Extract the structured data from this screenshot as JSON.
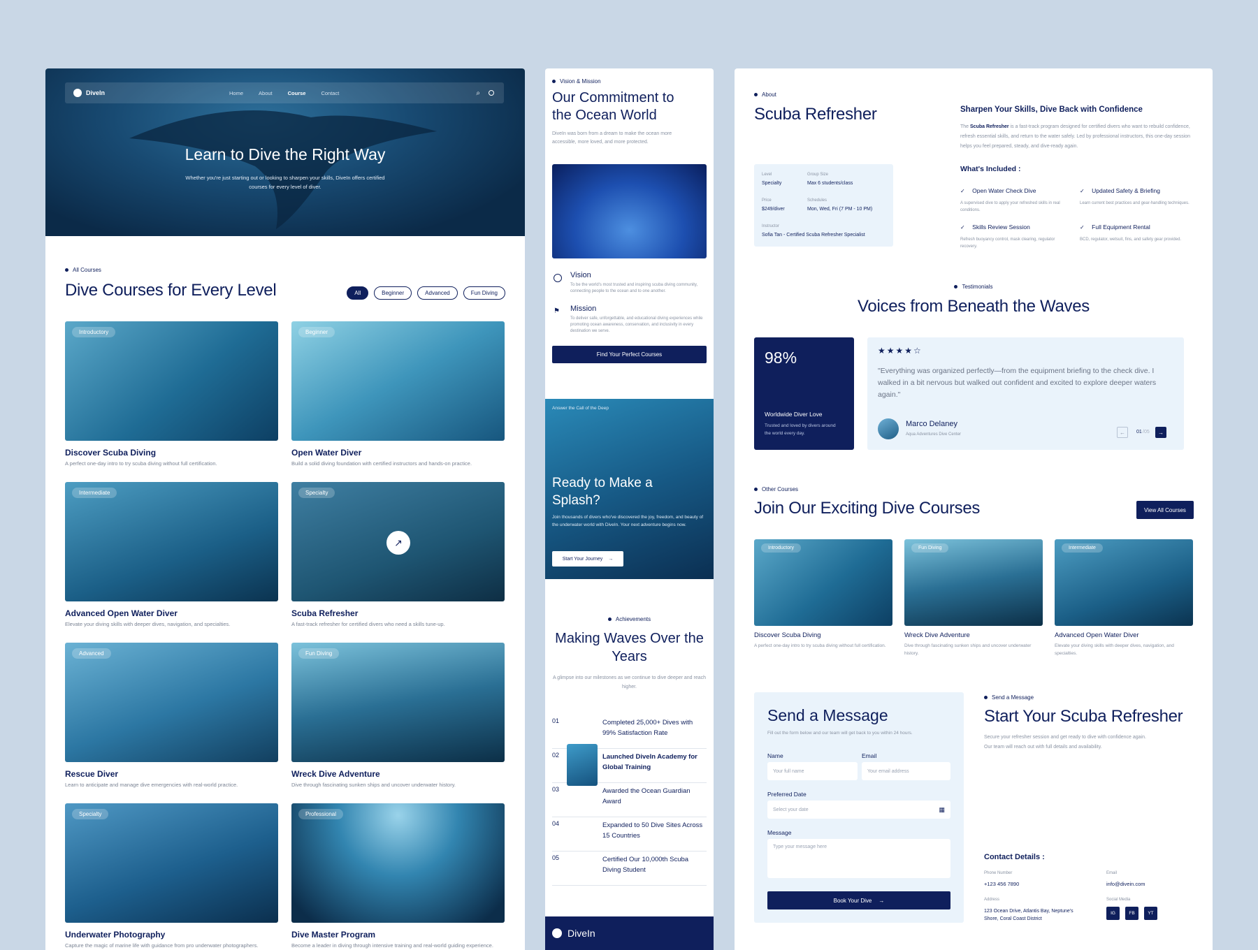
{
  "panel1": {
    "brand": "DiveIn",
    "nav": [
      "Home",
      "About",
      "Course",
      "Contact"
    ],
    "hero_title": "Learn to Dive the Right Way",
    "hero_sub": "Whether you're just starting out or looking to sharpen your skills, DiveIn offers certified courses for every level of diver.",
    "section_label": "All Courses",
    "section_title": "Dive Courses for Every Level",
    "filters": [
      "All",
      "Beginner",
      "Advanced",
      "Fun Diving"
    ],
    "courses": [
      {
        "tag": "Introductory",
        "title": "Discover Scuba Diving",
        "desc": "A perfect one-day intro to try scuba diving without full certification."
      },
      {
        "tag": "Beginner",
        "title": "Open Water Diver",
        "desc": "Build a solid diving foundation with certified instructors and hands-on practice."
      },
      {
        "tag": "Intermediate",
        "title": "Advanced Open Water Diver",
        "desc": "Elevate your diving skills with deeper dives, navigation, and specialties."
      },
      {
        "tag": "Specialty",
        "title": "Scuba Refresher",
        "desc": "A fast-track refresher for certified divers who need a skills tune-up."
      },
      {
        "tag": "Advanced",
        "title": "Rescue Diver",
        "desc": "Learn to anticipate and manage dive emergencies with real-world practice."
      },
      {
        "tag": "Fun Diving",
        "title": "Wreck Dive Adventure",
        "desc": "Dive through fascinating sunken ships and uncover underwater history."
      },
      {
        "tag": "Specialty",
        "title": "Underwater Photography",
        "desc": "Capture the magic of marine life with guidance from pro underwater photographers."
      },
      {
        "tag": "Professional",
        "title": "Dive Master Program",
        "desc": "Become a leader in diving through intensive training and real-world guiding experience."
      }
    ]
  },
  "panel2": {
    "label": "Vision & Mission",
    "title": "Our Commitment to the Ocean World",
    "desc": "DiveIn was born from a dream to make the ocean more accessible, more loved, and more protected.",
    "vision_title": "Vision",
    "vision_desc": "To be the world's most trusted and inspiring scuba diving community, connecting people to the ocean and to one another.",
    "mission_title": "Mission",
    "mission_desc": "To deliver safe, unforgettable, and educational diving experiences while promoting ocean awareness, conservation, and inclusivity in every destination we serve.",
    "cta": "Find Your Perfect Courses",
    "splash_label": "Answer the Call of the Deep",
    "splash_title": "Ready to Make a Splash?",
    "splash_desc": "Join thousands of divers who've discovered the joy, freedom, and beauty of the underwater world with DiveIn. Your next adventure begins now.",
    "splash_btn": "Start Your Journey",
    "ach_label": "Achievements",
    "ach_title": "Making Waves Over the Years",
    "ach_desc": "A glimpse into our milestones as we continue to dive deeper and reach higher.",
    "milestones": [
      {
        "num": "01",
        "text": "Completed 25,000+ Dives with 99% Satisfaction Rate"
      },
      {
        "num": "02",
        "text": "Launched DiveIn Academy for Global Training"
      },
      {
        "num": "03",
        "text": "Awarded the Ocean Guardian Award"
      },
      {
        "num": "04",
        "text": "Expanded to 50 Dive Sites Across 15 Countries"
      },
      {
        "num": "05",
        "text": "Certified Our 10,000th Scuba Diving Student"
      }
    ],
    "footer_brand": "DiveIn"
  },
  "panel3": {
    "label": "About",
    "title": "Scuba Refresher",
    "info": {
      "level_lbl": "Level",
      "level": "Specialty",
      "group_lbl": "Group Size",
      "group": "Max 6 students/class",
      "price_lbl": "Price",
      "price": "$249/diver",
      "sched_lbl": "Schedules",
      "sched": "Mon, Wed, Fri (7 PM - 10 PM)",
      "instr_lbl": "Instructor",
      "instr": "Sofia Tan - Certified Scuba Refresher Specialist"
    },
    "sharpen_title": "Sharpen Your Skills, Dive Back with Confidence",
    "sharpen_pre": "The ",
    "sharpen_link": "Scuba Refresher",
    "sharpen_post": " is a fast-track program designed for certified divers who want to rebuild confidence, refresh essential skills, and return to the water safely. Led by professional instructors, this one-day session helps you feel prepared, steady, and dive-ready again.",
    "included_title": "What's Included :",
    "included": [
      {
        "title": "Open Water Check Dive",
        "desc": "A supervised dive to apply your refreshed skills in real conditions."
      },
      {
        "title": "Updated Safety & Briefing",
        "desc": "Learn current best practices and gear-handling techniques."
      },
      {
        "title": "Skills Review Session",
        "desc": "Refresh buoyancy control, mask clearing, regulator recovery."
      },
      {
        "title": "Full Equipment Rental",
        "desc": "BCD, regulator, wetsuit, fins, and safety gear provided."
      }
    ],
    "testi_label": "Testimonials",
    "testi_title": "Voices from Beneath the Waves",
    "stat_value": "98%",
    "stat_title": "Worldwide Diver Love",
    "stat_desc": "Trusted and loved by divers around the world every day.",
    "stars": "★★★★☆",
    "quote": "\"Everything was organized perfectly—from the equipment briefing to the check dive. I walked in a bit nervous but walked out confident and excited to explore deeper waters again.\"",
    "reviewer": "Marco Delaney",
    "reviewer_org": "Aqua Adventures Dive Center",
    "pager": "01",
    "pager_total": "/05",
    "other_label": "Other Courses",
    "other_title": "Join Our Exciting Dive Courses",
    "view_all": "View All Courses",
    "other": [
      {
        "tag": "Introductory",
        "title": "Discover Scuba Diving",
        "desc": "A perfect one-day intro to try scuba diving without full certification."
      },
      {
        "tag": "Fun Diving",
        "title": "Wreck Dive Adventure",
        "desc": "Dive through fascinating sunken ships and uncover underwater history."
      },
      {
        "tag": "Intermediate",
        "title": "Advanced Open Water Diver",
        "desc": "Elevate your diving skills with deeper dives, navigation, and specialties."
      }
    ],
    "form_title": "Send a Message",
    "form_desc": "Fill out the form below and our team will get back to you within 24 hours.",
    "name_lbl": "Name",
    "name_ph": "Your full name",
    "email_lbl": "Email",
    "email_ph": "Your email address",
    "date_lbl": "Preferred Date",
    "date_ph": "Select your date",
    "msg_lbl": "Message",
    "msg_ph": "Type your message here",
    "book_btn": "Book Your Dive",
    "send_label": "Send a Message",
    "start_title": "Start Your Scuba Refresher",
    "start_desc": "Secure your refresher session and get ready to dive with confidence again. Our team will reach out with full details and availability.",
    "contact_title": "Contact Details :",
    "phone_lbl": "Phone Number",
    "phone": "+123 456 7890",
    "email2_lbl": "Email",
    "email2": "info@divein.com",
    "addr_lbl": "Address",
    "addr": "123 Ocean Drive, Atlantis Bay, Neptune's Shore, Coral Coast District",
    "social_lbl": "Social Media",
    "socials": [
      "IG",
      "FB",
      "YT"
    ]
  },
  "colors": {
    "navy": "#0f1f5c",
    "bg": "#c9d7e6",
    "light_blue": "#eaf3fb"
  }
}
